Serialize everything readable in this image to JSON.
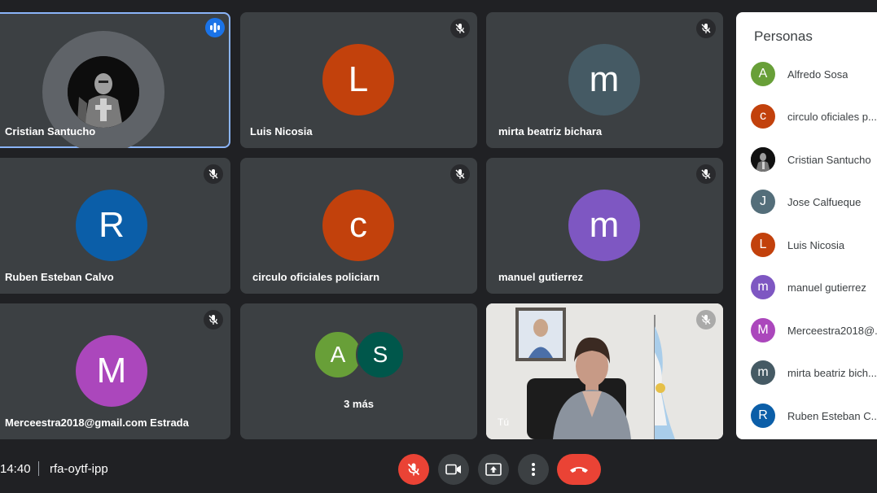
{
  "tiles": [
    {
      "name": "Cristian Santucho",
      "initial": "",
      "color": "",
      "status": "speaking"
    },
    {
      "name": "Luis Nicosia",
      "initial": "L",
      "color": "#c2410c",
      "status": "muted"
    },
    {
      "name": "mirta beatriz bichara",
      "initial": "m",
      "color": "#455a64",
      "status": "muted"
    },
    {
      "name": "Ruben Esteban Calvo",
      "initial": "R",
      "color": "#0b5ea8",
      "status": "muted"
    },
    {
      "name": "circulo oficiales policiarn",
      "initial": "c",
      "color": "#c2410c",
      "status": "muted"
    },
    {
      "name": "manuel gutierrez",
      "initial": "m",
      "color": "#7e57c2",
      "status": "muted"
    },
    {
      "name": "Merceestra2018@gmail.com Estrada",
      "initial": "M",
      "color": "#ab47bc",
      "status": "muted"
    }
  ],
  "more_tile": {
    "avatars": [
      {
        "initial": "A",
        "color": "#689f38"
      },
      {
        "initial": "S",
        "color": "#00574b"
      }
    ],
    "label": "3 más"
  },
  "self_tile": {
    "label": "Tú",
    "status": "muted"
  },
  "people_panel": {
    "title": "Personas",
    "people": [
      {
        "name": "Alfredo Sosa",
        "initial": "A",
        "color": "#689f38"
      },
      {
        "name": "circulo oficiales p...",
        "initial": "c",
        "color": "#c2410c"
      },
      {
        "name": "Cristian Santucho",
        "initial": "",
        "color": "#111111"
      },
      {
        "name": "Jose Calfueque",
        "initial": "J",
        "color": "#546e7a"
      },
      {
        "name": "Luis Nicosia",
        "initial": "L",
        "color": "#c2410c"
      },
      {
        "name": "manuel gutierrez",
        "initial": "m",
        "color": "#7e57c2"
      },
      {
        "name": "Merceestra2018@...",
        "initial": "M",
        "color": "#ab47bc"
      },
      {
        "name": "mirta beatriz bich...",
        "initial": "m",
        "color": "#455a64"
      },
      {
        "name": "Ruben Esteban C...",
        "initial": "R",
        "color": "#0b5ea8"
      }
    ]
  },
  "meeting": {
    "time": "14:40",
    "code": "rfa-oytf-ipp"
  },
  "controls": {
    "mic": "mic-off-icon",
    "camera": "videocam-icon",
    "present": "present-screen-icon",
    "more": "more-vert-icon",
    "end_call": "call-end-icon"
  },
  "colors": {
    "background": "#202124",
    "tile": "#3c4043",
    "active_border": "#8ab4f8",
    "danger": "#ea4335",
    "speaking": "#1a73e8"
  }
}
